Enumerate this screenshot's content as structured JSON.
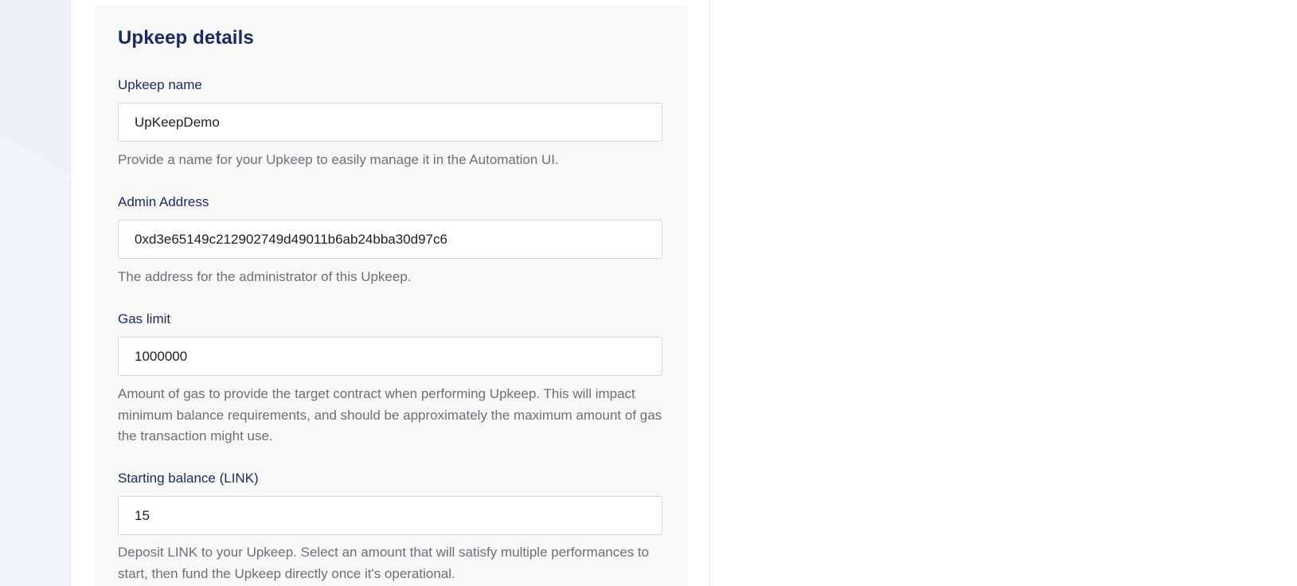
{
  "section": {
    "title": "Upkeep details"
  },
  "fields": {
    "upkeep_name": {
      "label": "Upkeep name",
      "value": "UpKeepDemo",
      "help": "Provide a name for your Upkeep to easily manage it in the Automation UI."
    },
    "admin_address": {
      "label": "Admin Address",
      "value": "0xd3e65149c212902749d49011b6ab24bba30d97c6",
      "help": "The address for the administrator of this Upkeep."
    },
    "gas_limit": {
      "label": "Gas limit",
      "value": "1000000",
      "help": "Amount of gas to provide the target contract when performing Upkeep. This will impact minimum balance requirements, and should be approximately the maximum amount of gas the transaction might use."
    },
    "starting_balance": {
      "label": "Starting balance (LINK)",
      "value": "15",
      "help": "Deposit LINK to your Upkeep. Select an amount that will satisfy multiple performances to start, then fund the Upkeep directly once it's operational."
    }
  },
  "colors": {
    "heading": "#1b2a5c",
    "help_text": "#6c6f78",
    "panel_background": "#f8f8f8",
    "input_border": "#d4d6dc"
  }
}
